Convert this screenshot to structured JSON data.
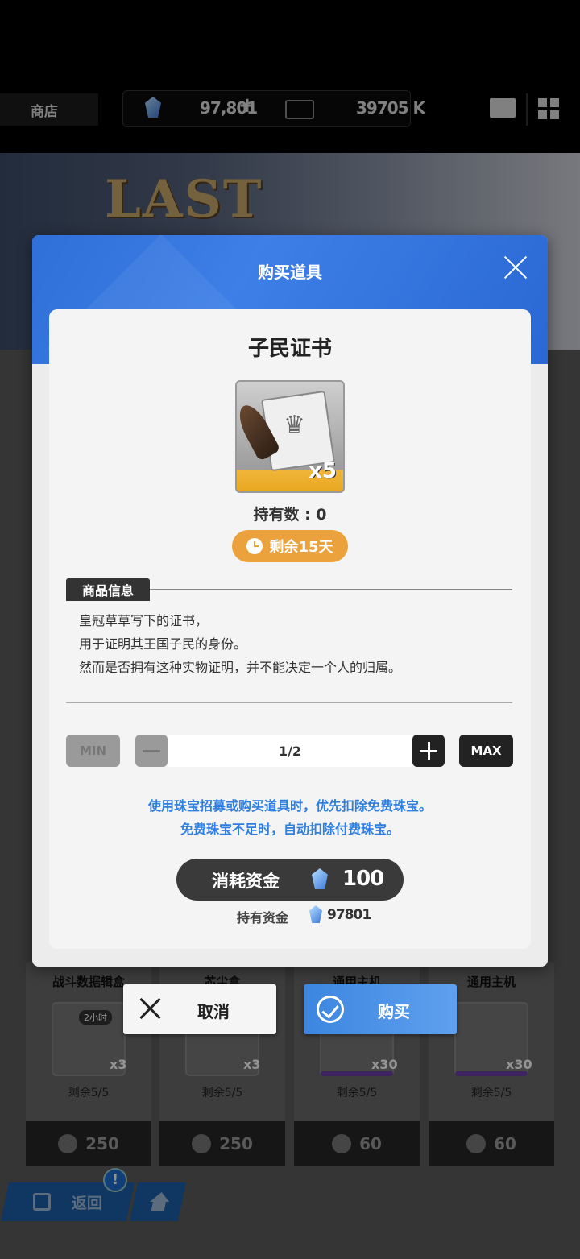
{
  "topbar": {
    "shop_tab": "商店",
    "gems": "97,801",
    "plus": "+",
    "gold": "39705 K"
  },
  "banner": {
    "title": "LAST"
  },
  "shop_cards": [
    {
      "name": "战斗数据辑盒",
      "qty": "x3",
      "duration": "2小时",
      "remaining": "剩余5/5",
      "price": "250"
    },
    {
      "name": "芯尘盒",
      "qty": "x3",
      "remaining": "剩余5/5",
      "price": "250"
    },
    {
      "name": "通用主机",
      "qty": "x30",
      "remaining": "剩余5/5",
      "price": "60"
    },
    {
      "name": "通用主机",
      "qty": "x30",
      "remaining": "剩余5/5",
      "price": "60"
    }
  ],
  "nav": {
    "back_label": "返回",
    "alert": "!"
  },
  "dialog": {
    "title": "购买道具",
    "item_name": "子民证书",
    "item_qty": "x5",
    "owned": "持有数 : 0",
    "time_left": "剩余15天",
    "info_tag": "商品信息",
    "description": [
      "皇冠草草写下的证书，",
      "用于证明其王国子民的身份。",
      "然而是否拥有这种实物证明，并不能决定一个人的归属。"
    ],
    "min_label": "MIN",
    "max_label": "MAX",
    "quantity": "1/2",
    "notice": [
      "使用珠宝招募或购买道具时，优先扣除免费珠宝。",
      "免费珠宝不足时，自动扣除付费珠宝。"
    ],
    "cost_label": "消耗资金",
    "cost_value": "100",
    "funds_label": "持有资金",
    "funds_value": "97801",
    "cancel_label": "取消",
    "buy_label": "购买"
  },
  "colors": {
    "accent_blue": "#2f6fd8",
    "badge_orange": "#eba23c",
    "notice_blue": "#2e7fe0"
  }
}
